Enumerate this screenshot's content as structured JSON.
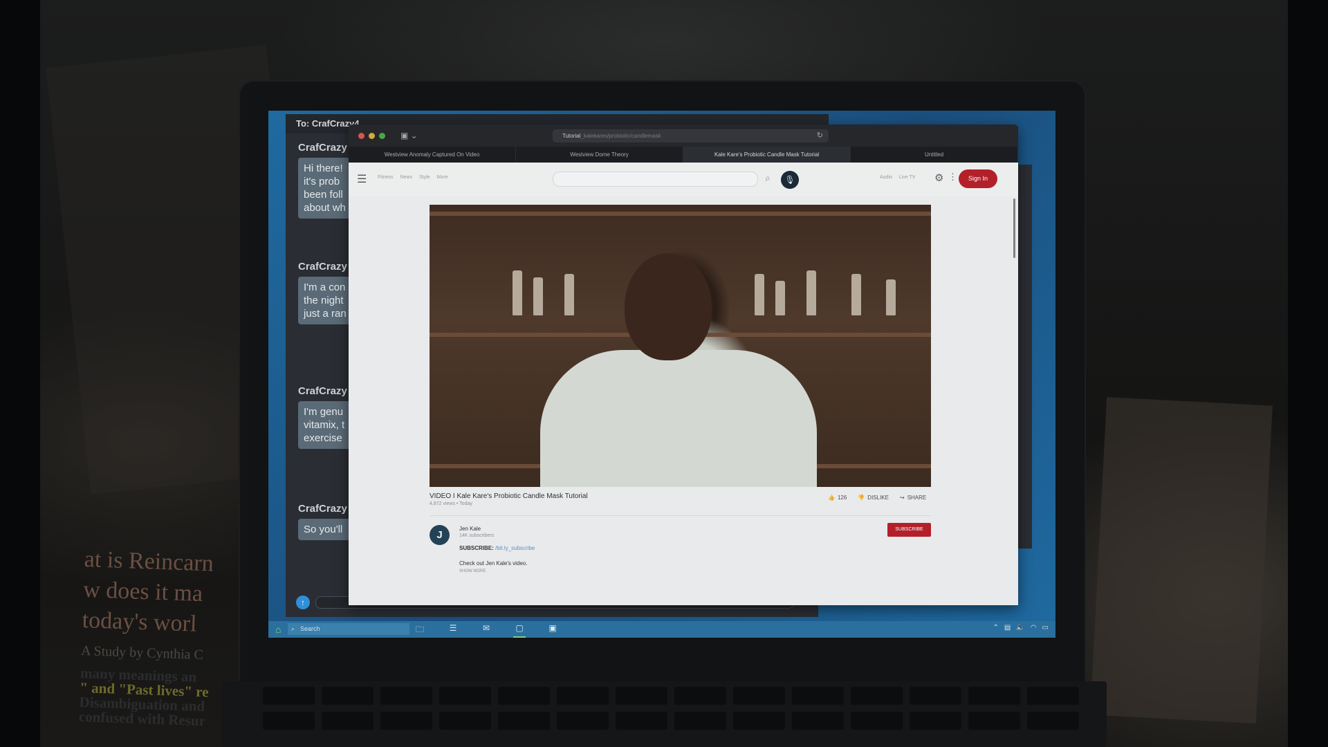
{
  "chat": {
    "header": "To: CrafCrazy4",
    "messages": [
      {
        "name": "CrafCrazy",
        "text": [
          "Hi there!",
          "it's prob",
          "been foll",
          "about wh"
        ]
      },
      {
        "name": "CrafCrazy",
        "text": [
          "I'm a con",
          "the night",
          "just a ran"
        ]
      },
      {
        "name": "CrafCrazy",
        "text": [
          "I'm genu",
          "vitamix, t",
          "exercise"
        ]
      },
      {
        "name": "CrafCrazy",
        "text": [
          "So you'll"
        ]
      }
    ]
  },
  "browser": {
    "url_domain": "Tutorial",
    "url_path": "_kalekares/probiotic/candlemask",
    "tabs": [
      {
        "label": "Westview Anomaly Captured On Video",
        "active": false
      },
      {
        "label": "Westview Dome Theory",
        "active": false
      },
      {
        "label": "Kale Kare's Probiotic Candle Mask Tutorial",
        "active": true
      },
      {
        "label": "Untitled",
        "active": false
      }
    ]
  },
  "site": {
    "nav": [
      "Fitness",
      "News",
      "Style",
      "More"
    ],
    "right_links": [
      "Audio",
      "Live TV"
    ],
    "signin_label": "Sign In"
  },
  "video": {
    "title": "VIDEO I Kale Kare's Probiotic Candle Mask Tutorial",
    "meta": "4,872 views • Today",
    "likes": "126",
    "dislike_label": "DISLIKE",
    "share_label": "SHARE",
    "channel_initial": "J",
    "channel_name": "Jen Kale",
    "subscribers": "14K subscribers",
    "subscribe_label": "SUBSCRIBE",
    "subscribe_prefix": "SUBSCRIBE: ",
    "subscribe_link": "/bit.ly_subscribe",
    "description": "Check out Jen Kale's video.",
    "show_more": "SHOW MORE"
  },
  "taskbar": {
    "search_placeholder": "Search"
  },
  "background": {
    "paper_lines": [
      "at is Reincarn",
      "w does it ma",
      "today's worl"
    ],
    "paper_sub": "A Study by Cynthia C",
    "paper_small": [
      "many meanings an",
      "\" and \"Past lives\" re",
      "Disambiguation and",
      "confused with Resur"
    ]
  },
  "colors": {
    "signin": "#b3202a",
    "taskbar": "#2b6f9e",
    "screen_bg": "#1f6aa0"
  }
}
